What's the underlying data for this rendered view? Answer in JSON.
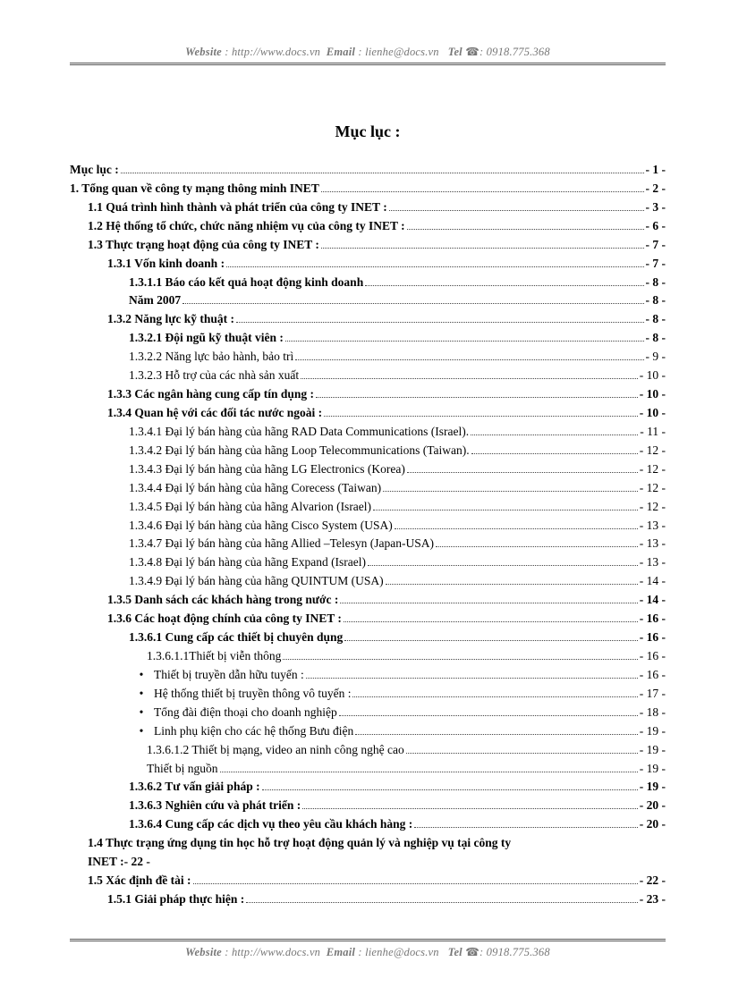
{
  "header": {
    "website_label": "Website",
    "website_sep": " : ",
    "website_url": "http://www.docs.vn",
    "email_label": "Email",
    "email_sep": " : ",
    "email_addr": "lienhe@docs.vn",
    "tel_label": "Tel",
    "tel_icon": "☎",
    "tel_sep": ": ",
    "tel_number": "0918.775.368"
  },
  "title": "Mục lục :",
  "entries": [
    {
      "indent": 0,
      "bold": true,
      "label": "Mục lục :",
      "page": "- 1 -"
    },
    {
      "indent": 0,
      "bold": true,
      "label": "1. Tổng quan về công ty mạng thông minh INET",
      "page": "- 2 -"
    },
    {
      "indent": 1,
      "bold": true,
      "label": "1.1 Quá trình hình thành và phát triển của công ty INET :",
      "page": "- 3 -"
    },
    {
      "indent": 1,
      "bold": true,
      "label": "1.2 Hệ thống tổ chức, chức năng nhiệm vụ của công ty INET :",
      "page": "- 6 -"
    },
    {
      "indent": 1,
      "bold": true,
      "label": "1.3 Thực trạng hoạt động của công ty INET :",
      "page": "- 7 -"
    },
    {
      "indent": 2,
      "bold": true,
      "label": "1.3.1 Vốn kinh doanh :",
      "page": "- 7 -"
    },
    {
      "indent": 3,
      "bold": true,
      "label": "1.3.1.1 Báo cáo kết quả hoạt động kinh doanh",
      "page": "- 8 -"
    },
    {
      "indent": 3,
      "bold": true,
      "label": "Năm 2007",
      "page": "- 8 -"
    },
    {
      "indent": 2,
      "bold": true,
      "label": "1.3.2 Năng lực kỹ thuật :",
      "page": "- 8 -"
    },
    {
      "indent": 3,
      "bold": true,
      "label": "1.3.2.1 Đội ngũ kỹ thuật viên :",
      "page": "- 8 -"
    },
    {
      "indent": 3,
      "bold": false,
      "label": "1.3.2.2 Năng lực bảo hành, bảo trì",
      "page": "- 9 -"
    },
    {
      "indent": 3,
      "bold": false,
      "label": "1.3.2.3 Hỗ trợ của các nhà sản xuất",
      "page": "- 10 -"
    },
    {
      "indent": 2,
      "bold": true,
      "label": "1.3.3 Các ngân hàng cung cấp tín dụng :",
      "page": "- 10 -"
    },
    {
      "indent": 2,
      "bold": true,
      "label": "1.3.4 Quan hệ với các đối tác nước ngoài :",
      "page": "- 10 -"
    },
    {
      "indent": 3,
      "bold": false,
      "label": "1.3.4.1 Đại lý bán hàng của hãng RAD Data Communications   (Israel).",
      "page": "- 11 -"
    },
    {
      "indent": 3,
      "bold": false,
      "label": "1.3.4.2 Đại lý bán hàng của hãng Loop Telecommunications    (Taiwan).",
      "page": "- 12 -"
    },
    {
      "indent": 3,
      "bold": false,
      "label": "1.3.4.3 Đại lý bán hàng của hãng LG Electronics  (Korea)",
      "page": "- 12 -"
    },
    {
      "indent": 3,
      "bold": false,
      "label": "1.3.4.4 Đại lý bán hàng của hãng Corecess (Taiwan)",
      "page": "- 12 -"
    },
    {
      "indent": 3,
      "bold": false,
      "label": "1.3.4.5 Đại lý bán hàng của hãng Alvarion  (Israel)",
      "page": "- 12 -"
    },
    {
      "indent": 3,
      "bold": false,
      "label": "1.3.4.6 Đại lý bán hàng của hãng Cisco System (USA)",
      "page": "- 13 -"
    },
    {
      "indent": 3,
      "bold": false,
      "label": "1.3.4.7 Đại lý bán hàng của hãng Allied –Telesyn  (Japan-USA)",
      "page": "- 13 -"
    },
    {
      "indent": 3,
      "bold": false,
      "label": "1.3.4.8 Đại lý bán hàng của hãng Expand (Israel)",
      "page": "- 13 -"
    },
    {
      "indent": 3,
      "bold": false,
      "label": "1.3.4.9 Đại lý bán hàng của hãng QUINTUM (USA)",
      "page": "- 14 -"
    },
    {
      "indent": 2,
      "bold": true,
      "label": "1.3.5 Danh sách các khách hàng trong nước :",
      "page": "- 14 -"
    },
    {
      "indent": 2,
      "bold": true,
      "label": "1.3.6 Các hoạt động chính của công ty INET :",
      "page": "- 16 -"
    },
    {
      "indent": 3,
      "bold": true,
      "label": "1.3.6.1 Cung cấp các thiết bị chuyên dụng",
      "page": "- 16 -"
    },
    {
      "indent": 4,
      "bold": false,
      "label": "1.3.6.1.1Thiết bị viễn thông",
      "page": "- 16 -"
    },
    {
      "indent": 3,
      "bold": false,
      "bullet": true,
      "label": "Thiết bị truyền dẫn hữu tuyến :",
      "page": "- 16 -"
    },
    {
      "indent": 3,
      "bold": false,
      "bullet": true,
      "label": "Hệ thống thiết bị truyền thông vô tuyến :",
      "page": "- 17 -"
    },
    {
      "indent": 3,
      "bold": false,
      "bullet": true,
      "label": "Tổng đài điện thoại cho doanh nghiệp",
      "page": "- 18 -"
    },
    {
      "indent": 3,
      "bold": false,
      "bullet": true,
      "label": "Linh phụ kiện cho các hệ thống Bưu điện",
      "page": "- 19 -"
    },
    {
      "indent": 4,
      "bold": false,
      "label": "1.3.6.1.2 Thiết bị mạng, video an ninh công nghệ cao",
      "page": "- 19 -"
    },
    {
      "indent": 4,
      "bold": false,
      "label": "Thiết bị nguồn",
      "page": "- 19 -"
    },
    {
      "indent": 3,
      "bold": true,
      "label": "1.3.6.2 Tư vấn giải pháp :",
      "page": "- 19 -"
    },
    {
      "indent": 3,
      "bold": true,
      "label": "1.3.6.3 Nghiên cứu và phát triển :",
      "page": "- 20 -"
    },
    {
      "indent": 3,
      "bold": true,
      "label": "1.3.6.4 Cung cấp các dịch vụ theo yêu cầu khách hàng :",
      "page": "- 20 -"
    },
    {
      "indent": 1,
      "bold": true,
      "multiline": true,
      "label1": "1.4 Thực trạng ứng dụng tin học hỗ trợ hoạt động quản lý và nghiệp vụ tại công ty",
      "label2": "INET :",
      "page": "- 22 -"
    },
    {
      "indent": 1,
      "bold": true,
      "label": "1.5 Xác định đề tài :",
      "page": "- 22 -"
    },
    {
      "indent": 2,
      "bold": true,
      "label": "1.5.1 Giải pháp thực hiện :",
      "page": "- 23 -"
    }
  ]
}
